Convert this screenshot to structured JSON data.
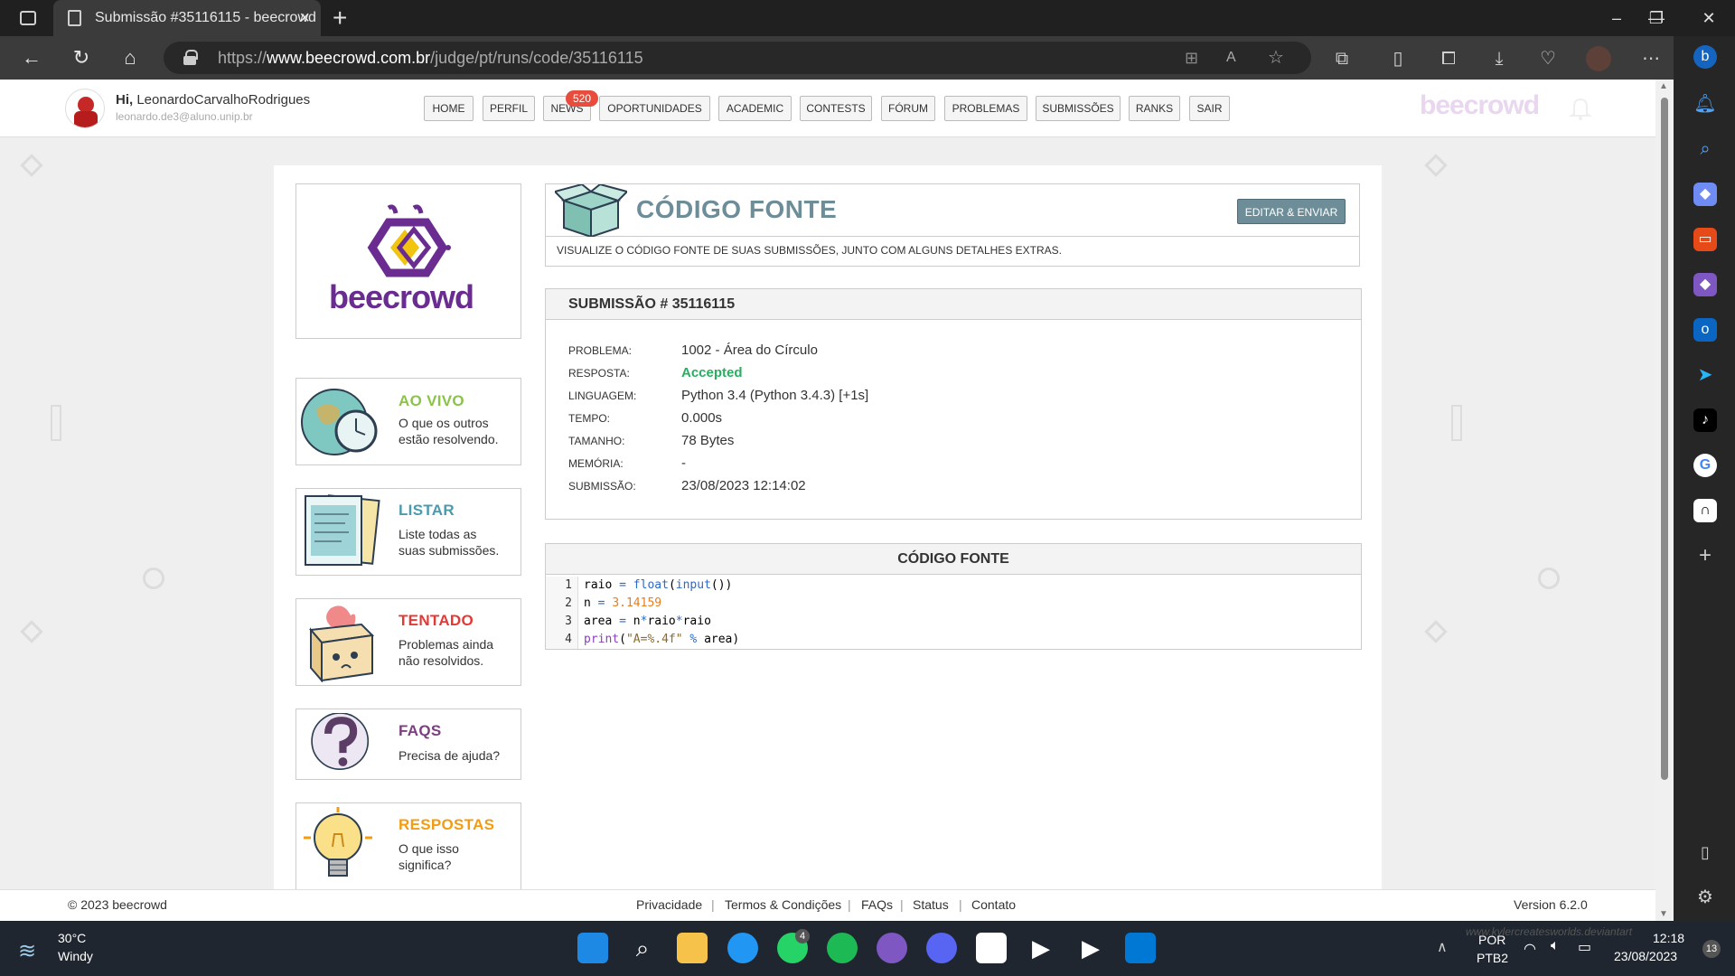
{
  "browser": {
    "tab_title": "Submissão #35116115 - beecrowd",
    "url_prefix": "https://",
    "url_host": "www.beecrowd.com.br",
    "url_path": "/judge/pt/runs/code/35116115"
  },
  "site": {
    "greeting_prefix": "Hi,",
    "user_name": "LeonardoCarvalhoRodrigues",
    "user_email": "leonardo.de3@aluno.unip.br",
    "brand": "beecrowd",
    "nav": [
      "HOME",
      "PERFIL",
      "NEWS",
      "OPORTUNIDADES",
      "ACADEMIC",
      "CONTESTS",
      "FÓRUM",
      "PROBLEMAS",
      "SUBMISSÕES",
      "RANKS",
      "SAIR"
    ],
    "news_badge": "520"
  },
  "sidebar": {
    "logo_text": "beecrowd",
    "items": [
      {
        "title": "AO VIVO",
        "desc1": "O que os outros",
        "desc2": "estão resolvendo.",
        "color": "#8bc34a"
      },
      {
        "title": "LISTAR",
        "desc1": "Liste todas as",
        "desc2": "suas submissões.",
        "color": "#4a9ab0"
      },
      {
        "title": "TENTADO",
        "desc1": "Problemas ainda",
        "desc2": "não resolvidos.",
        "color": "#e53935"
      },
      {
        "title": "FAQS",
        "desc1": "Precisa de ajuda?",
        "desc2": "",
        "color": "#7b3f80"
      },
      {
        "title": "RESPOSTAS",
        "desc1": "O que isso",
        "desc2": "significa?",
        "color": "#f39c12"
      }
    ]
  },
  "header": {
    "title": "CÓDIGO FONTE",
    "edit_button": "EDITAR & ENVIAR",
    "subtitle": "VISUALIZE O CÓDIGO FONTE DE SUAS SUBMISSÕES, JUNTO COM ALGUNS DETALHES EXTRAS."
  },
  "submission": {
    "heading": "SUBMISSÃO # 35116115",
    "fields": [
      {
        "label": "PROBLEMA:",
        "value": "1002 - Área do Círculo"
      },
      {
        "label": "RESPOSTA:",
        "value": "Accepted"
      },
      {
        "label": "LINGUAGEM:",
        "value": "Python 3.4 (Python 3.4.3) [+1s]"
      },
      {
        "label": "TEMPO:",
        "value": "0.000s"
      },
      {
        "label": "TAMANHO:",
        "value": "78 Bytes"
      },
      {
        "label": "MEMÓRIA:",
        "value": "-"
      },
      {
        "label": "SUBMISSÃO:",
        "value": "23/08/2023 12:14:02"
      }
    ],
    "accepted_color": "#27ae60"
  },
  "code": {
    "heading": "CÓDIGO FONTE",
    "line_numbers": [
      "1",
      "2",
      "3",
      "4"
    ],
    "lines": [
      [
        {
          "t": "raio ",
          "c": ""
        },
        {
          "t": "=",
          "c": "kw"
        },
        {
          "t": " ",
          "c": ""
        },
        {
          "t": "float",
          "c": "kw"
        },
        {
          "t": "(",
          "c": ""
        },
        {
          "t": "input",
          "c": "kw"
        },
        {
          "t": "())",
          "c": ""
        }
      ],
      [
        {
          "t": "n ",
          "c": ""
        },
        {
          "t": "=",
          "c": "kw"
        },
        {
          "t": " ",
          "c": ""
        },
        {
          "t": "3.14159",
          "c": "num"
        }
      ],
      [
        {
          "t": "area ",
          "c": ""
        },
        {
          "t": "=",
          "c": "kw"
        },
        {
          "t": " n",
          "c": ""
        },
        {
          "t": "*",
          "c": "kw"
        },
        {
          "t": "raio",
          "c": ""
        },
        {
          "t": "*",
          "c": "kw"
        },
        {
          "t": "raio",
          "c": ""
        }
      ],
      [
        {
          "t": "print",
          "c": "pr"
        },
        {
          "t": "(",
          "c": ""
        },
        {
          "t": "\"A=%.4f\"",
          "c": "str"
        },
        {
          "t": " ",
          "c": ""
        },
        {
          "t": "%",
          "c": "kw"
        },
        {
          "t": " area)",
          "c": ""
        }
      ]
    ]
  },
  "footer": {
    "copyright": "© 2023 beecrowd",
    "links": [
      "Privacidade",
      "Termos & Condições",
      "FAQs",
      "Status",
      "Contato"
    ],
    "version": "Version 6.2.0"
  },
  "taskbar": {
    "weather_temp": "30°C",
    "weather_desc": "Windy",
    "lang1": "POR",
    "lang2": "PTB2",
    "time": "12:18",
    "date": "23/08/2023",
    "notif_count": "13",
    "whatsapp_badge": "4",
    "watermark": "www.kylercreatesworlds.deviantart"
  }
}
